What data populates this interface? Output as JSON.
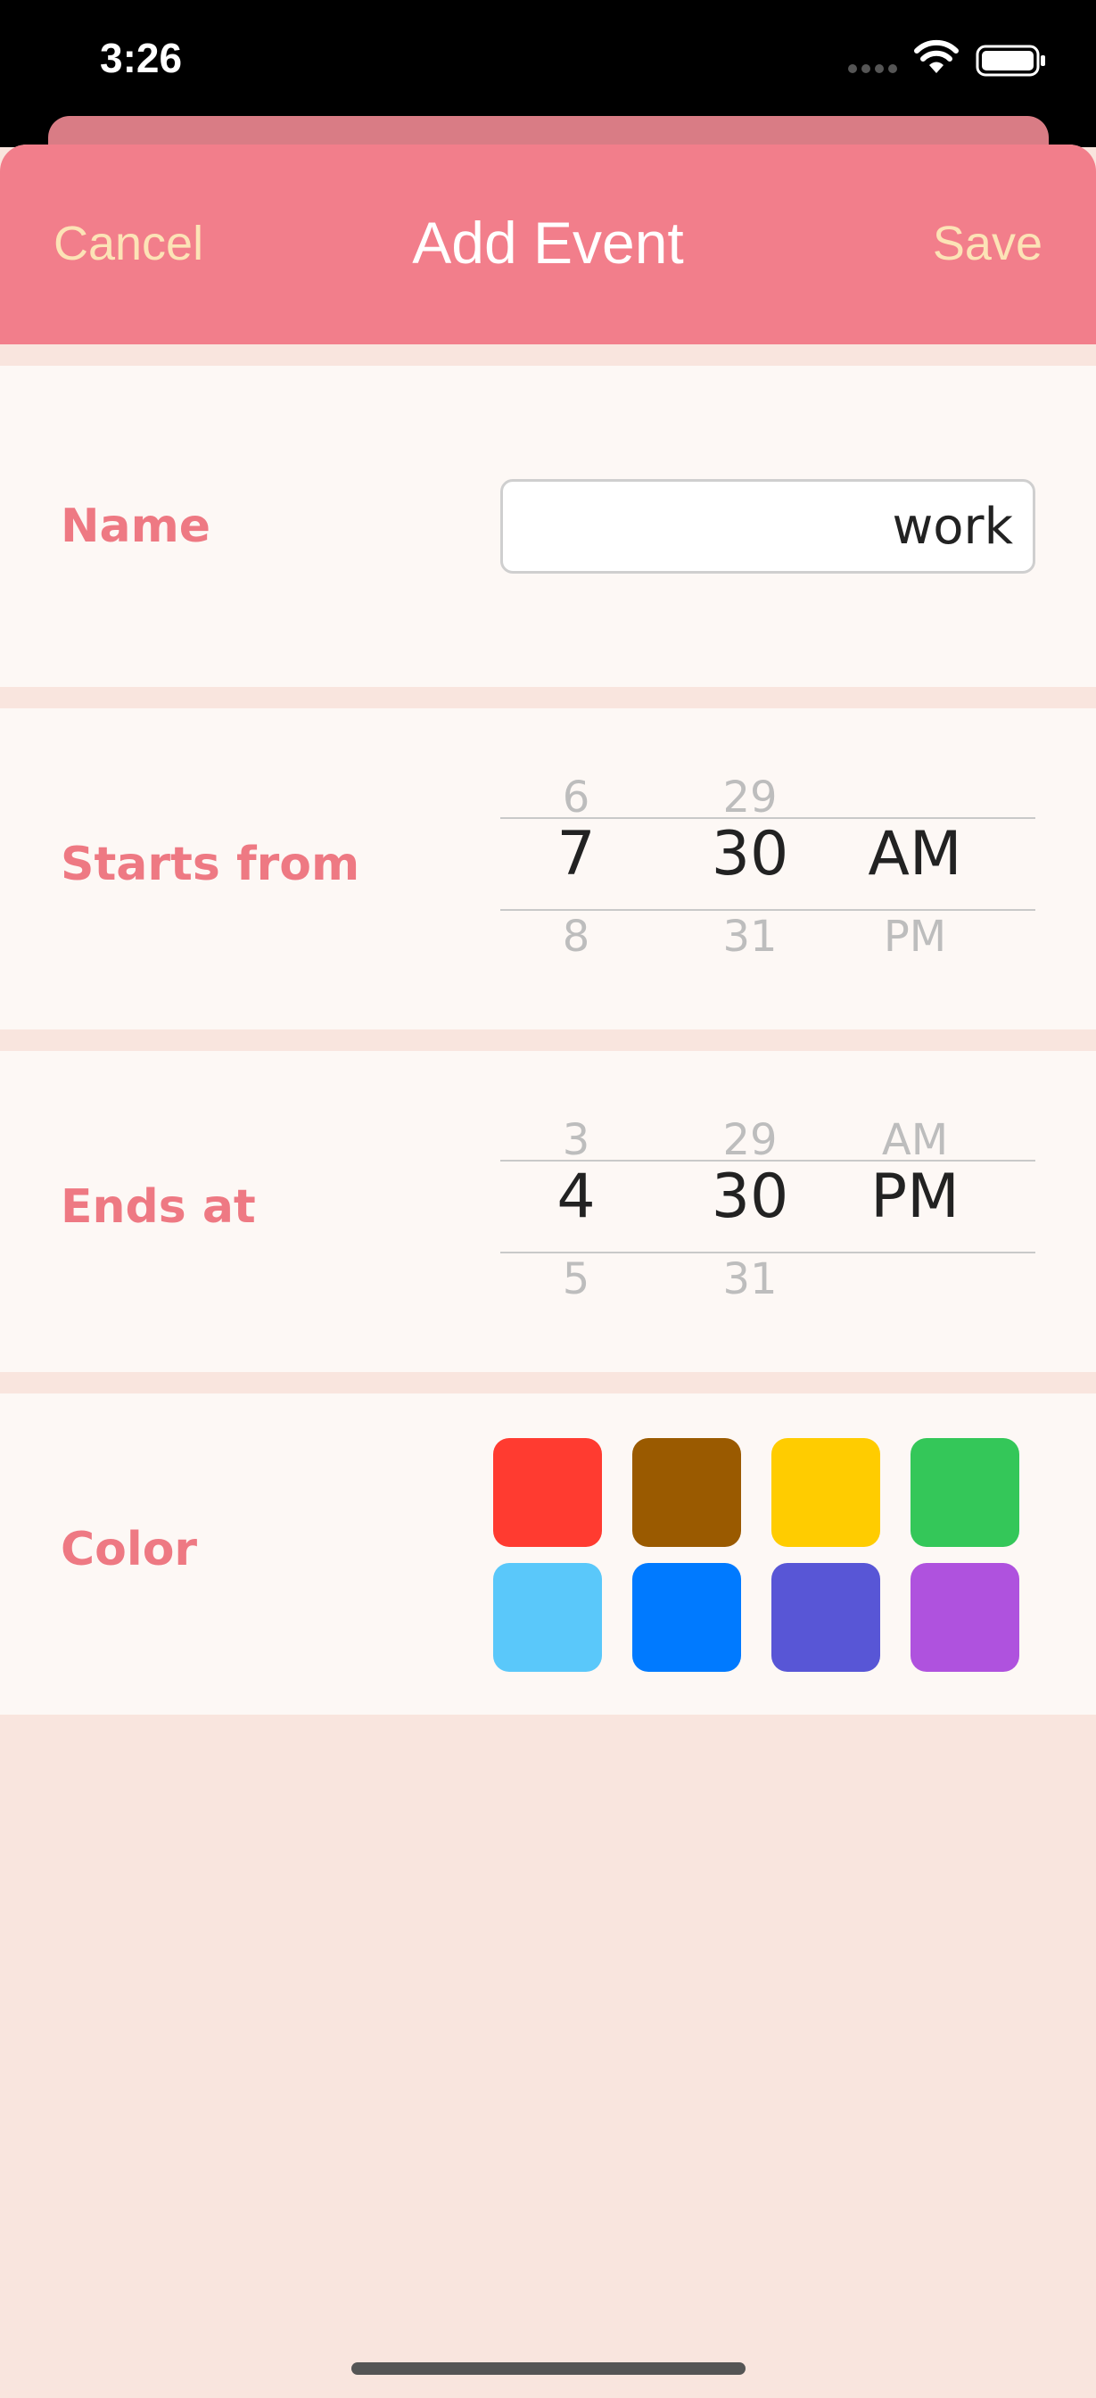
{
  "status_bar": {
    "time": "3:26",
    "icons": [
      "cellular-signal-icon",
      "wifi-icon",
      "battery-icon"
    ]
  },
  "nav": {
    "cancel_label": "Cancel",
    "title": "Add Event",
    "save_label": "Save"
  },
  "name_row": {
    "label": "Name",
    "value": "work"
  },
  "starts_row": {
    "label": "Starts from",
    "hour": {
      "prev": "6",
      "selected": "7",
      "next": "8"
    },
    "minute": {
      "prev": "29",
      "selected": "30",
      "next": "31"
    },
    "period": {
      "prev": "",
      "selected": "AM",
      "next": "PM"
    }
  },
  "ends_row": {
    "label": "Ends at",
    "hour": {
      "prev": "3",
      "selected": "4",
      "next": "5"
    },
    "minute": {
      "prev": "29",
      "selected": "30",
      "next": "31"
    },
    "period": {
      "prev": "AM",
      "selected": "PM",
      "next": ""
    }
  },
  "color_row": {
    "label": "Color",
    "swatches": [
      "#FF3B30",
      "#9A5A00",
      "#FFCC00",
      "#34C759",
      "#5AC8FA",
      "#007AFF",
      "#5856D6",
      "#AF52DE"
    ]
  },
  "theme": {
    "accent": "#F27E8B",
    "label_color": "#EE7983",
    "nav_button_color": "#FCE3B6",
    "background": "#F9E5DE"
  }
}
